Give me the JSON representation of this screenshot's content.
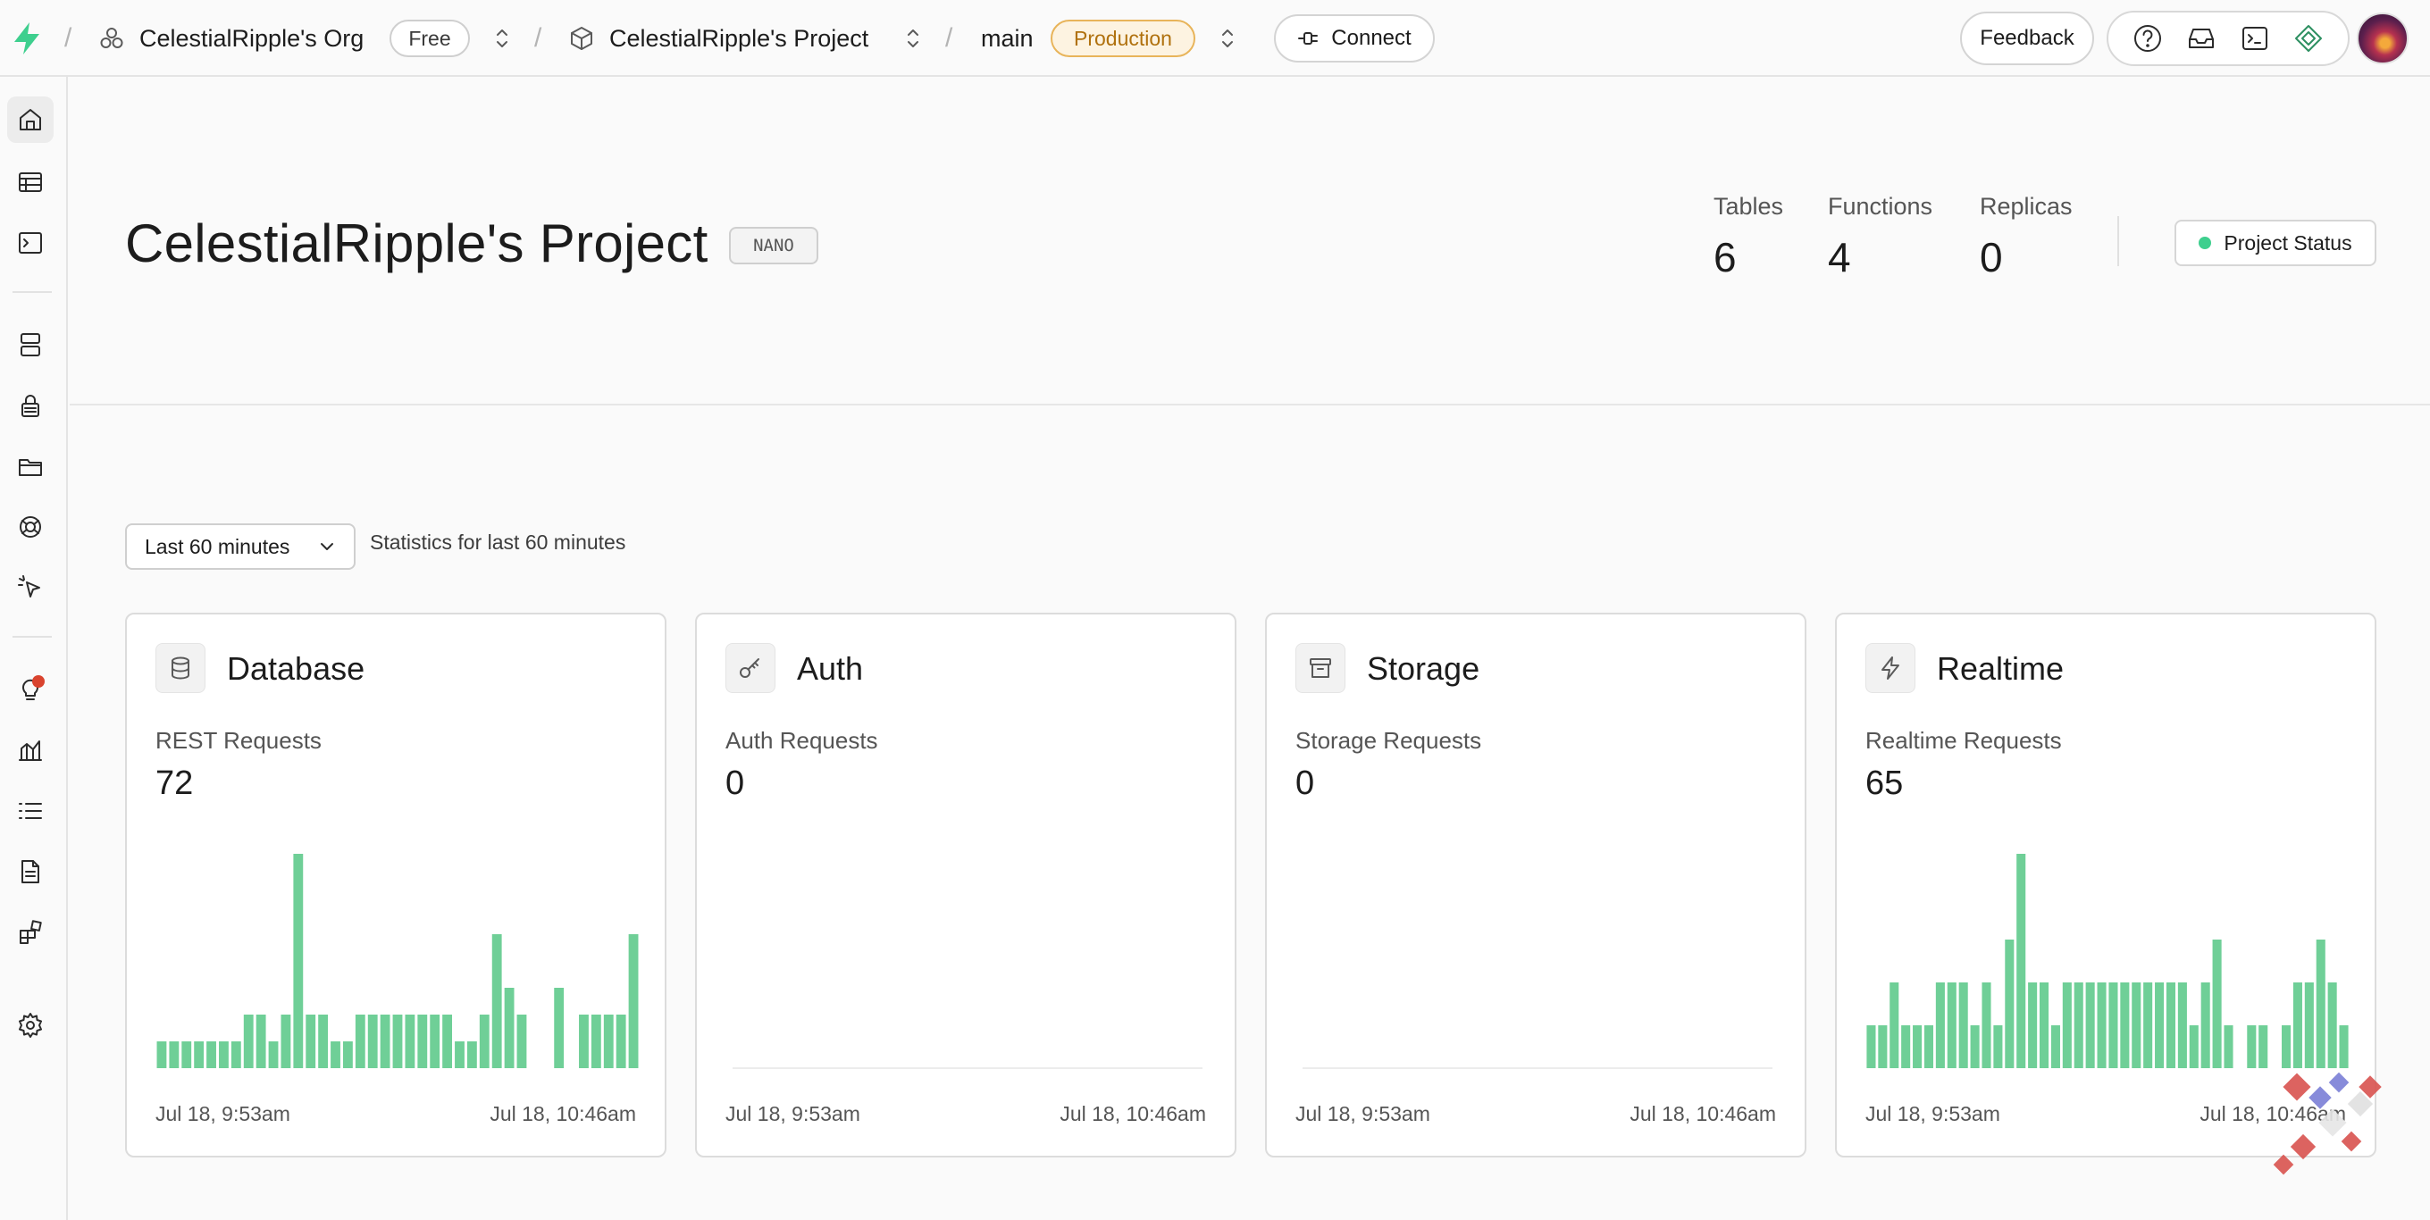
{
  "topbar": {
    "org_name": "CelestialRipple's Org",
    "org_plan": "Free",
    "project_name": "CelestialRipple's Project",
    "branch": "main",
    "branch_env": "Production",
    "connect_label": "Connect",
    "feedback_label": "Feedback"
  },
  "sidebar": {
    "items": [
      "home-icon",
      "table-editor-icon",
      "sql-editor-icon",
      "database-icon",
      "auth-icon",
      "storage-icon",
      "realtime-icon",
      "edge-functions-icon",
      "advisors-icon",
      "reports-icon",
      "logs-icon",
      "api-docs-icon",
      "integrations-icon",
      "settings-icon"
    ]
  },
  "header": {
    "title": "CelestialRipple's Project",
    "tier": "NANO",
    "stats": [
      {
        "label": "Tables",
        "value": "6"
      },
      {
        "label": "Functions",
        "value": "4"
      },
      {
        "label": "Replicas",
        "value": "0"
      }
    ],
    "status_label": "Project Status"
  },
  "filter": {
    "selected": "Last 60 minutes",
    "note": "Statistics for last 60 minutes"
  },
  "colors": {
    "bar": "#6fcf97",
    "accent_green": "#3ecf8e"
  },
  "cards": [
    {
      "title": "Database",
      "icon": "database-icon",
      "metric_label": "REST Requests",
      "metric_value": "72",
      "start": "Jul 18, 9:53am",
      "end": "Jul 18, 10:46am",
      "bars": [
        1,
        1,
        1,
        1,
        1,
        1,
        1,
        2,
        2,
        1,
        2,
        8,
        2,
        2,
        1,
        1,
        2,
        2,
        2,
        2,
        2,
        2,
        2,
        2,
        1,
        1,
        2,
        5,
        3,
        2,
        0,
        0,
        3,
        0,
        2,
        2,
        2,
        2,
        5
      ]
    },
    {
      "title": "Auth",
      "icon": "key-icon",
      "metric_label": "Auth Requests",
      "metric_value": "0",
      "start": "Jul 18, 9:53am",
      "end": "Jul 18, 10:46am",
      "bars": []
    },
    {
      "title": "Storage",
      "icon": "archive-icon",
      "metric_label": "Storage Requests",
      "metric_value": "0",
      "start": "Jul 18, 9:53am",
      "end": "Jul 18, 10:46am",
      "bars": []
    },
    {
      "title": "Realtime",
      "icon": "bolt-icon",
      "metric_label": "Realtime Requests",
      "metric_value": "65",
      "start": "Jul 18, 9:53am",
      "end": "Jul 18, 10:46am",
      "bars": [
        1,
        1,
        2,
        1,
        1,
        1,
        2,
        2,
        2,
        1,
        2,
        1,
        3,
        5,
        2,
        2,
        1,
        2,
        2,
        2,
        2,
        2,
        2,
        2,
        2,
        2,
        2,
        2,
        1,
        2,
        3,
        1,
        0,
        1,
        1,
        0,
        1,
        2,
        2,
        3,
        2,
        1
      ]
    }
  ]
}
